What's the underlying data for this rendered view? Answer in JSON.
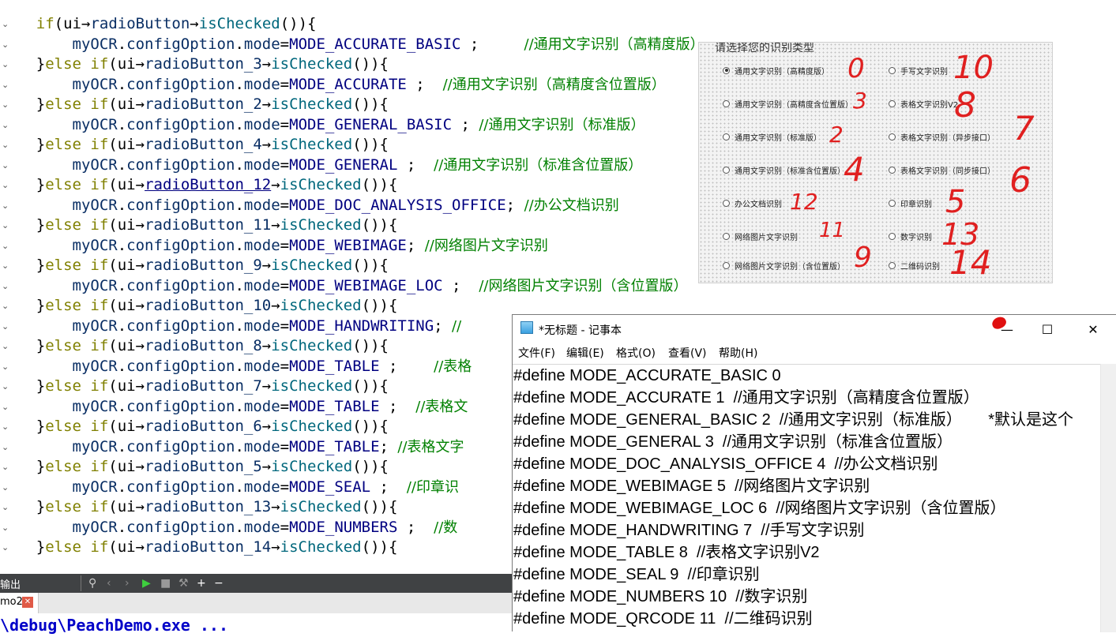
{
  "editor": {
    "lines": [
      {
        "indent": "    ",
        "parts": [
          [
            "kw",
            "if"
          ],
          [
            "",
            "("
          ],
          [
            "",
            "ui"
          ],
          [
            "",
            "→"
          ],
          [
            "obj",
            "radioButton"
          ],
          [
            "",
            "→"
          ],
          [
            "fn",
            "isChecked"
          ],
          [
            "",
            "()){"
          ]
        ]
      },
      {
        "indent": "        ",
        "parts": [
          [
            "obj",
            "myOCR"
          ],
          [
            "",
            "."
          ],
          [
            "obj",
            "configOption"
          ],
          [
            "",
            "."
          ],
          [
            "obj",
            "mode"
          ],
          [
            "",
            "="
          ],
          [
            "mac",
            "MODE_ACCURATE_BASIC"
          ],
          [
            "",
            " ;     "
          ],
          [
            "cm",
            "//通用文字识别（高精度版）"
          ]
        ]
      },
      {
        "indent": "    ",
        "parts": [
          [
            "",
            "}"
          ],
          [
            "kw",
            "else if"
          ],
          [
            "",
            "(ui→"
          ],
          [
            "obj",
            "radioButton_3"
          ],
          [
            "",
            "→"
          ],
          [
            "fn",
            "isChecked"
          ],
          [
            "",
            "()){"
          ]
        ]
      },
      {
        "indent": "        ",
        "parts": [
          [
            "obj",
            "myOCR"
          ],
          [
            "",
            "."
          ],
          [
            "obj",
            "configOption"
          ],
          [
            "",
            "."
          ],
          [
            "obj",
            "mode"
          ],
          [
            "",
            "="
          ],
          [
            "mac",
            "MODE_ACCURATE"
          ],
          [
            "",
            " ;  "
          ],
          [
            "cm",
            "//通用文字识别（高精度含位置版）"
          ]
        ]
      },
      {
        "indent": "    ",
        "parts": [
          [
            "",
            "}"
          ],
          [
            "kw",
            "else if"
          ],
          [
            "",
            "(ui→"
          ],
          [
            "obj",
            "radioButton_2"
          ],
          [
            "",
            "→"
          ],
          [
            "fn",
            "isChecked"
          ],
          [
            "",
            "()){"
          ]
        ]
      },
      {
        "indent": "        ",
        "parts": [
          [
            "obj",
            "myOCR"
          ],
          [
            "",
            "."
          ],
          [
            "obj",
            "configOption"
          ],
          [
            "",
            "."
          ],
          [
            "obj",
            "mode"
          ],
          [
            "",
            "="
          ],
          [
            "mac",
            "MODE_GENERAL_BASIC"
          ],
          [
            "",
            " ; "
          ],
          [
            "cm",
            "//通用文字识别（标准版）"
          ]
        ]
      },
      {
        "indent": "    ",
        "parts": [
          [
            "",
            "}"
          ],
          [
            "kw",
            "else if"
          ],
          [
            "",
            "(ui→"
          ],
          [
            "obj",
            "radioButton_4"
          ],
          [
            "",
            "→"
          ],
          [
            "fn",
            "isChecked"
          ],
          [
            "",
            "()){"
          ]
        ]
      },
      {
        "indent": "        ",
        "parts": [
          [
            "obj",
            "myOCR"
          ],
          [
            "",
            "."
          ],
          [
            "obj",
            "configOption"
          ],
          [
            "",
            "."
          ],
          [
            "obj",
            "mode"
          ],
          [
            "",
            "="
          ],
          [
            "mac",
            "MODE_GENERAL"
          ],
          [
            "",
            " ;  "
          ],
          [
            "cm",
            "//通用文字识别（标准含位置版）"
          ]
        ]
      },
      {
        "indent": "    ",
        "parts": [
          [
            "",
            "}"
          ],
          [
            "kw",
            "else if"
          ],
          [
            "",
            "(ui→"
          ],
          [
            "lnk",
            "radioButton_12"
          ],
          [
            "",
            "→"
          ],
          [
            "fn",
            "isChecked"
          ],
          [
            "",
            "()){"
          ]
        ]
      },
      {
        "indent": "        ",
        "parts": [
          [
            "obj",
            "myOCR"
          ],
          [
            "",
            "."
          ],
          [
            "obj",
            "configOption"
          ],
          [
            "",
            "."
          ],
          [
            "obj",
            "mode"
          ],
          [
            "",
            "="
          ],
          [
            "mac",
            "MODE_DOC_ANALYSIS_OFFICE"
          ],
          [
            "",
            "; "
          ],
          [
            "cm",
            "//办公文档识别"
          ]
        ]
      },
      {
        "indent": "    ",
        "parts": [
          [
            "",
            "}"
          ],
          [
            "kw",
            "else if"
          ],
          [
            "",
            "(ui→"
          ],
          [
            "obj",
            "radioButton_11"
          ],
          [
            "",
            "→"
          ],
          [
            "fn",
            "isChecked"
          ],
          [
            "",
            "()){"
          ]
        ]
      },
      {
        "indent": "        ",
        "parts": [
          [
            "obj",
            "myOCR"
          ],
          [
            "",
            "."
          ],
          [
            "obj",
            "configOption"
          ],
          [
            "",
            "."
          ],
          [
            "obj",
            "mode"
          ],
          [
            "",
            "="
          ],
          [
            "mac",
            "MODE_WEBIMAGE"
          ],
          [
            "",
            "; "
          ],
          [
            "cm",
            "//网络图片文字识别"
          ]
        ]
      },
      {
        "indent": "    ",
        "parts": [
          [
            "",
            "}"
          ],
          [
            "kw",
            "else if"
          ],
          [
            "",
            "(ui→"
          ],
          [
            "obj",
            "radioButton_9"
          ],
          [
            "",
            "→"
          ],
          [
            "fn",
            "isChecked"
          ],
          [
            "",
            "()){"
          ]
        ]
      },
      {
        "indent": "        ",
        "parts": [
          [
            "obj",
            "myOCR"
          ],
          [
            "",
            "."
          ],
          [
            "obj",
            "configOption"
          ],
          [
            "",
            "."
          ],
          [
            "obj",
            "mode"
          ],
          [
            "",
            "="
          ],
          [
            "mac",
            "MODE_WEBIMAGE_LOC"
          ],
          [
            "",
            " ;  "
          ],
          [
            "cm",
            "//网络图片文字识别（含位置版）"
          ]
        ]
      },
      {
        "indent": "    ",
        "parts": [
          [
            "",
            "}"
          ],
          [
            "kw",
            "else if"
          ],
          [
            "",
            "(ui→"
          ],
          [
            "obj",
            "radioButton_10"
          ],
          [
            "",
            "→"
          ],
          [
            "fn",
            "isChecked"
          ],
          [
            "",
            "()){"
          ]
        ]
      },
      {
        "indent": "        ",
        "parts": [
          [
            "obj",
            "myOCR"
          ],
          [
            "",
            "."
          ],
          [
            "obj",
            "configOption"
          ],
          [
            "",
            "."
          ],
          [
            "obj",
            "mode"
          ],
          [
            "",
            "="
          ],
          [
            "mac",
            "MODE_HANDWRITING"
          ],
          [
            "",
            "; "
          ],
          [
            "cm",
            "//"
          ]
        ]
      },
      {
        "indent": "    ",
        "parts": [
          [
            "",
            "}"
          ],
          [
            "kw",
            "else if"
          ],
          [
            "",
            "(ui→"
          ],
          [
            "obj",
            "radioButton_8"
          ],
          [
            "",
            "→"
          ],
          [
            "fn",
            "isChecked"
          ],
          [
            "",
            "()){"
          ]
        ]
      },
      {
        "indent": "        ",
        "parts": [
          [
            "obj",
            "myOCR"
          ],
          [
            "",
            "."
          ],
          [
            "obj",
            "configOption"
          ],
          [
            "",
            "."
          ],
          [
            "obj",
            "mode"
          ],
          [
            "",
            "="
          ],
          [
            "mac",
            "MODE_TABLE"
          ],
          [
            "",
            " ;    "
          ],
          [
            "cm",
            "//表格"
          ]
        ]
      },
      {
        "indent": "    ",
        "parts": [
          [
            "",
            "}"
          ],
          [
            "kw",
            "else if"
          ],
          [
            "",
            "(ui→"
          ],
          [
            "obj",
            "radioButton_7"
          ],
          [
            "",
            "→"
          ],
          [
            "fn",
            "isChecked"
          ],
          [
            "",
            "()){"
          ]
        ]
      },
      {
        "indent": "        ",
        "parts": [
          [
            "obj",
            "myOCR"
          ],
          [
            "",
            "."
          ],
          [
            "obj",
            "configOption"
          ],
          [
            "",
            "."
          ],
          [
            "obj",
            "mode"
          ],
          [
            "",
            "="
          ],
          [
            "mac",
            "MODE_TABLE"
          ],
          [
            "",
            " ;  "
          ],
          [
            "cm",
            "//表格文"
          ]
        ]
      },
      {
        "indent": "    ",
        "parts": [
          [
            "",
            "}"
          ],
          [
            "kw",
            "else if"
          ],
          [
            "",
            "(ui→"
          ],
          [
            "obj",
            "radioButton_6"
          ],
          [
            "",
            "→"
          ],
          [
            "fn",
            "isChecked"
          ],
          [
            "",
            "()){"
          ]
        ]
      },
      {
        "indent": "        ",
        "parts": [
          [
            "obj",
            "myOCR"
          ],
          [
            "",
            "."
          ],
          [
            "obj",
            "configOption"
          ],
          [
            "",
            "."
          ],
          [
            "obj",
            "mode"
          ],
          [
            "",
            "="
          ],
          [
            "mac",
            "MODE_TABLE"
          ],
          [
            "",
            "; "
          ],
          [
            "cm",
            "//表格文字"
          ]
        ]
      },
      {
        "indent": "    ",
        "parts": [
          [
            "",
            "}"
          ],
          [
            "kw",
            "else if"
          ],
          [
            "",
            "(ui→"
          ],
          [
            "obj",
            "radioButton_5"
          ],
          [
            "",
            "→"
          ],
          [
            "fn",
            "isChecked"
          ],
          [
            "",
            "()){"
          ]
        ]
      },
      {
        "indent": "        ",
        "parts": [
          [
            "obj",
            "myOCR"
          ],
          [
            "",
            "."
          ],
          [
            "obj",
            "configOption"
          ],
          [
            "",
            "."
          ],
          [
            "obj",
            "mode"
          ],
          [
            "",
            "="
          ],
          [
            "mac",
            "MODE_SEAL"
          ],
          [
            "",
            " ;  "
          ],
          [
            "cm",
            "//印章识"
          ]
        ]
      },
      {
        "indent": "    ",
        "parts": [
          [
            "",
            "}"
          ],
          [
            "kw",
            "else if"
          ],
          [
            "",
            "(ui→"
          ],
          [
            "obj",
            "radioButton_13"
          ],
          [
            "",
            "→"
          ],
          [
            "fn",
            "isChecked"
          ],
          [
            "",
            "()){"
          ]
        ]
      },
      {
        "indent": "        ",
        "parts": [
          [
            "obj",
            "myOCR"
          ],
          [
            "",
            "."
          ],
          [
            "obj",
            "configOption"
          ],
          [
            "",
            "."
          ],
          [
            "obj",
            "mode"
          ],
          [
            "",
            "="
          ],
          [
            "mac",
            "MODE_NUMBERS"
          ],
          [
            "",
            " ;  "
          ],
          [
            "cm",
            "//数"
          ]
        ]
      },
      {
        "indent": "    ",
        "parts": [
          [
            "",
            "}"
          ],
          [
            "kw",
            "else if"
          ],
          [
            "",
            "(ui→"
          ],
          [
            "obj",
            "radioButton_14"
          ],
          [
            "",
            "→"
          ],
          [
            "fn",
            "isChecked"
          ],
          [
            "",
            "()){"
          ]
        ]
      }
    ]
  },
  "output_panel": {
    "title": "输出",
    "tab_label": "mo2",
    "output_text": "\\debug\\PeachDemo.exe ..."
  },
  "designer": {
    "group_title": "请选择您的识别类型",
    "options": [
      {
        "label": "通用文字识别（高精度版）",
        "checked": true
      },
      {
        "label": "手写文字识别",
        "checked": false
      },
      {
        "label": "通用文字识别（高精度含位置版）",
        "checked": false
      },
      {
        "label": "表格文字识别V2",
        "checked": false
      },
      {
        "label": "通用文字识别（标准版）",
        "checked": false
      },
      {
        "label": "表格文字识别（异步接口）",
        "checked": false
      },
      {
        "label": "通用文字识别（标准含位置版）",
        "checked": false
      },
      {
        "label": "表格文字识别（同步接口）",
        "checked": false
      },
      {
        "label": "办公文档识别",
        "checked": false
      },
      {
        "label": "印章识别",
        "checked": false
      },
      {
        "label": "网络图片文字识别",
        "checked": false
      },
      {
        "label": "数字识别",
        "checked": false
      },
      {
        "label": "网络图片文字识别（含位置版）",
        "checked": false
      },
      {
        "label": "二维码识别",
        "checked": false
      }
    ],
    "handwritten_numbers": [
      "0",
      "10",
      "3",
      "8",
      "7",
      "2",
      "4",
      "6",
      "12",
      "5",
      "11",
      "13",
      "9",
      "14"
    ]
  },
  "notepad": {
    "title": "*无标题 - 记事本",
    "menu": [
      "文件(F)",
      "编辑(E)",
      "格式(O)",
      "查看(V)",
      "帮助(H)"
    ],
    "lines": [
      "#define MODE_ACCURATE_BASIC 0",
      "#define MODE_ACCURATE 1  //通用文字识别（高精度含位置版）",
      "#define MODE_GENERAL_BASIC 2  //通用文字识别（标准版）      *默认是这个",
      "#define MODE_GENERAL 3  //通用文字识别（标准含位置版）",
      "#define MODE_DOC_ANALYSIS_OFFICE 4  //办公文档识别",
      "#define MODE_WEBIMAGE 5  //网络图片文字识别",
      "#define MODE_WEBIMAGE_LOC 6  //网络图片文字识别（含位置版）",
      "#define MODE_HANDWRITING 7  //手写文字识别",
      "#define MODE_TABLE 8  //表格文字识别V2",
      "#define MODE_SEAL 9  //印章识别",
      "#define MODE_NUMBERS 10  //数字识别",
      "#define MODE_QRCODE 11  //二维码识别"
    ],
    "minimize_glyph": "—",
    "maximize_glyph": "☐",
    "close_glyph": "✕"
  },
  "colors": {
    "keyword": "#808000",
    "object": "#092e64",
    "function": "#00677c",
    "macro": "#000080",
    "comment": "#008000",
    "handwriting": "#e02020"
  },
  "icons": [
    "fold-arrow-icon",
    "filter-icon",
    "prev-icon",
    "next-icon",
    "run-icon",
    "stop-icon",
    "build-icon",
    "plus-icon",
    "minus-icon",
    "close-tab-icon",
    "notepad-app-icon",
    "ladybug-icon"
  ]
}
